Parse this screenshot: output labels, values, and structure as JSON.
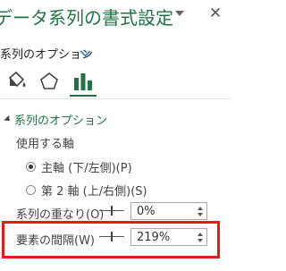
{
  "header": {
    "title": "データ系列の書式設定",
    "close_glyph": "✕"
  },
  "options_selector": {
    "label": "系列のオプション"
  },
  "category_tabs": [
    {
      "icon": "paint-bucket-icon"
    },
    {
      "icon": "pentagon-icon"
    },
    {
      "icon": "bar-chart-icon",
      "selected": true
    }
  ],
  "section": {
    "title": "系列のオプション",
    "axis_label": "使用する軸",
    "primary_axis_label": "主軸 (下/左側)(P)",
    "secondary_axis_label": "第 2 軸 (上/右側)(S)",
    "primary_selected": true
  },
  "overlap": {
    "label": "系列の重なり(O)",
    "value": "0%"
  },
  "gap_width": {
    "label": "要素の間隔(W)",
    "value": "219%"
  },
  "colors": {
    "accent": "#217346",
    "highlight": "#e8191b"
  }
}
